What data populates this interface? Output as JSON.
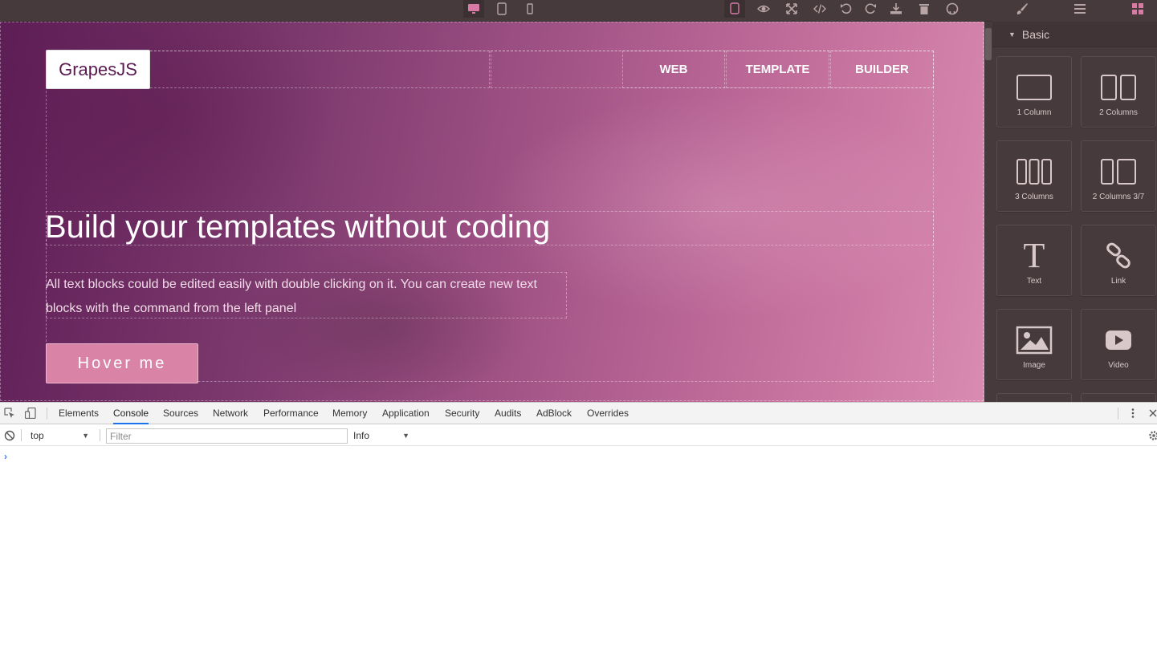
{
  "toolbar": {
    "devices": [
      {
        "name": "desktop-icon",
        "active": true
      },
      {
        "name": "tablet-icon",
        "active": false
      },
      {
        "name": "mobile-icon",
        "active": false
      }
    ],
    "options": [
      "sw-visibility-icon",
      "preview-icon",
      "fullscreen-icon",
      "code-icon",
      "undo-icon",
      "redo-icon",
      "import-icon",
      "clear-canvas-icon",
      "github-icon"
    ],
    "panels": [
      "style-manager-icon",
      "layer-manager-icon",
      "blocks-icon"
    ],
    "accent_color": "#d97aa5"
  },
  "canvas": {
    "logo": "GrapesJS",
    "nav": [
      "WEB",
      "TEMPLATE",
      "BUILDER"
    ],
    "hero_title": "Build your templates without coding",
    "hero_text": "All text blocks could be edited easily with double clicking on it. You can create new text blocks with the command from the left panel",
    "hero_button": "Hover me"
  },
  "blocks": {
    "category": "Basic",
    "items": [
      {
        "label": "1 Column",
        "icon": "one-column-icon"
      },
      {
        "label": "2 Columns",
        "icon": "two-columns-icon"
      },
      {
        "label": "3 Columns",
        "icon": "three-columns-icon"
      },
      {
        "label": "2 Columns 3/7",
        "icon": "two-columns-37-icon"
      },
      {
        "label": "Text",
        "icon": "text-icon"
      },
      {
        "label": "Link",
        "icon": "link-icon"
      },
      {
        "label": "Image",
        "icon": "image-icon"
      },
      {
        "label": "Video",
        "icon": "video-icon"
      }
    ]
  },
  "devtools": {
    "tabs": [
      "Elements",
      "Console",
      "Sources",
      "Network",
      "Performance",
      "Memory",
      "Application",
      "Security",
      "Audits",
      "AdBlock",
      "Overrides"
    ],
    "active_tab": "Console",
    "context": "top",
    "filter_placeholder": "Filter",
    "level": "Info",
    "prompt": "›"
  }
}
